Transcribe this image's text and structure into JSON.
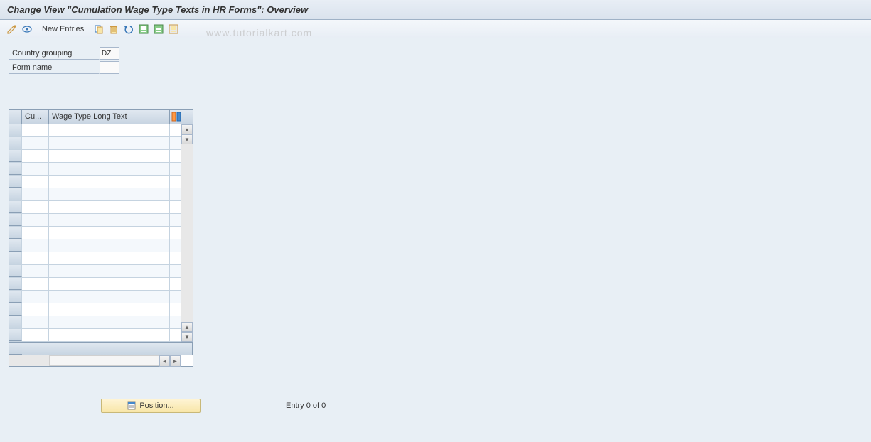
{
  "header": {
    "title": "Change View \"Cumulation Wage Type Texts in HR Forms\": Overview"
  },
  "toolbar": {
    "new_entries_label": "New Entries"
  },
  "watermark": "www.tutorialkart.com",
  "fields": {
    "country_grouping": {
      "label": "Country grouping",
      "value": "DZ"
    },
    "form_name": {
      "label": "Form name",
      "value": ""
    }
  },
  "table": {
    "columns": {
      "col1": "Cu...",
      "col2": "Wage Type Long Text"
    },
    "row_count": 17
  },
  "footer": {
    "position_label": "Position...",
    "entry_text": "Entry 0 of 0"
  }
}
